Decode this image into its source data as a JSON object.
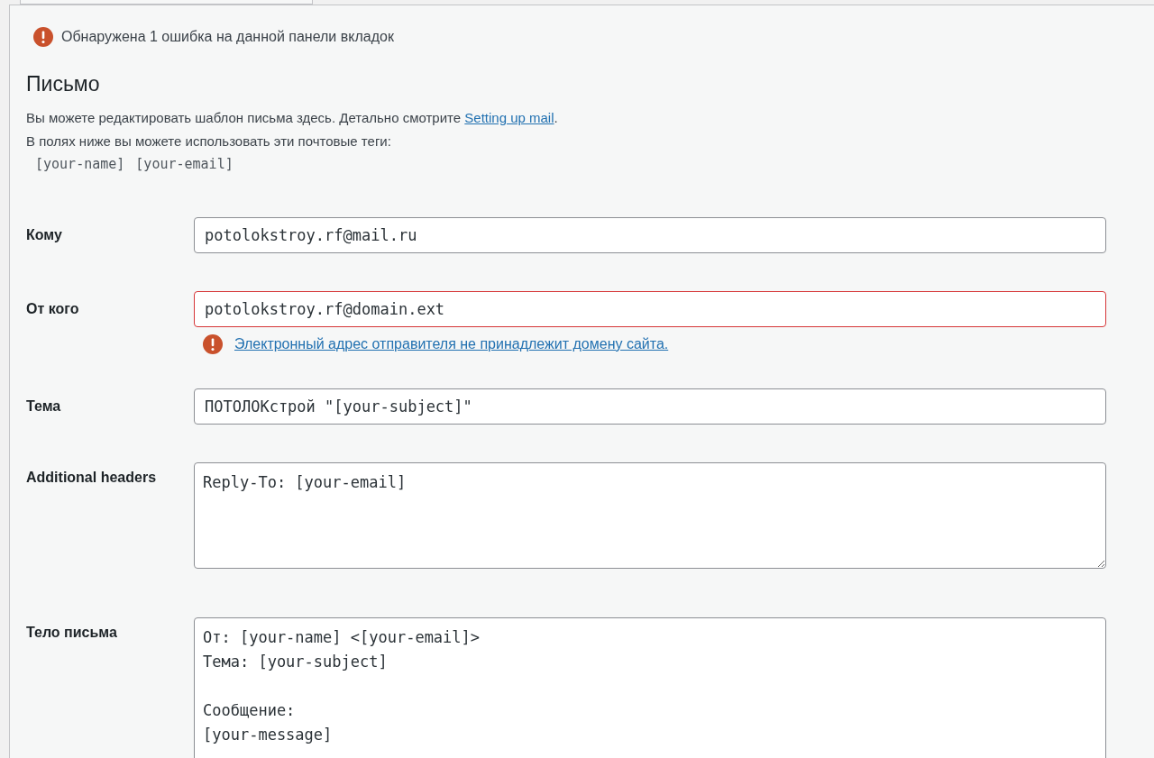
{
  "tab": {
    "selected": true
  },
  "notice": {
    "text": "Обнаружена 1 ошибка на данной панели вкладок"
  },
  "section": {
    "title": "Письмо",
    "description": "Вы можете редактировать шаблон письма здесь. Детально смотрите ",
    "link": "Setting up mail",
    "description_end": ".",
    "tags_intro": "В полях ниже вы можете использовать эти почтовые теги:",
    "tags": [
      "[your-name]",
      "[your-email]"
    ]
  },
  "fields": [
    {
      "label": "Кому",
      "kind": "input",
      "value": "potolokstroy.rf@mail.ru",
      "invalid": false
    },
    {
      "label": "От кого",
      "kind": "input",
      "value": "potolokstroy.rf@domain.ext",
      "invalid": true,
      "error": "Электронный адрес отправителя не принадлежит домену сайта."
    },
    {
      "label": "Тема",
      "kind": "input",
      "value": "ПОТОЛОКстрой \"[your-subject]\"",
      "invalid": false
    },
    {
      "label": "Additional headers",
      "kind": "textarea",
      "value": "Reply-To: [your-email]",
      "invalid": false
    },
    {
      "label": "Тело письма",
      "kind": "body",
      "value": "От: [your-name] <[your-email]>\nТема: [your-subject]\n\nСообщение:\n[your-message]",
      "invalid": false
    }
  ]
}
